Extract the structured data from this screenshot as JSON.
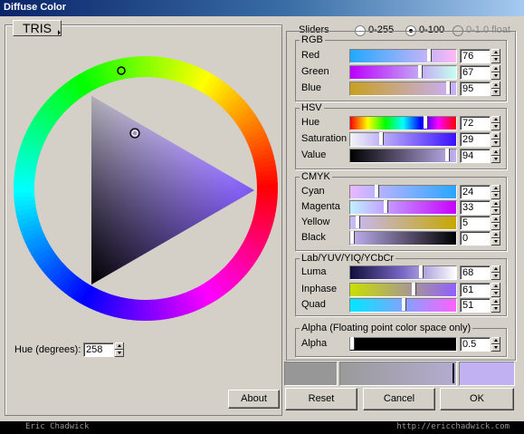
{
  "window": {
    "title": "Diffuse Color"
  },
  "left": {
    "mode_button": "TRIS",
    "hue_label": "Hue (degrees):",
    "hue_value": "258",
    "about_button": "About"
  },
  "sliders": {
    "label": "Sliders",
    "radios": [
      {
        "label": "0-255",
        "selected": false
      },
      {
        "label": "0-100",
        "selected": true
      },
      {
        "label": "0-1.0 float",
        "selected": false,
        "disabled": true
      }
    ]
  },
  "groups": {
    "rgb": {
      "title": "RGB",
      "rows": [
        {
          "label": "Red",
          "value": "76"
        },
        {
          "label": "Green",
          "value": "67"
        },
        {
          "label": "Blue",
          "value": "95"
        }
      ]
    },
    "hsv": {
      "title": "HSV",
      "rows": [
        {
          "label": "Hue",
          "value": "72"
        },
        {
          "label": "Saturation",
          "value": "29"
        },
        {
          "label": "Value",
          "value": "94"
        }
      ]
    },
    "cmyk": {
      "title": "CMYK",
      "rows": [
        {
          "label": "Cyan",
          "value": "24"
        },
        {
          "label": "Magenta",
          "value": "33"
        },
        {
          "label": "Yellow",
          "value": "5"
        },
        {
          "label": "Black",
          "value": "0"
        }
      ]
    },
    "lab": {
      "title": "Lab/YUV/YIQ/YCbCr",
      "rows": [
        {
          "label": "Luma",
          "value": "68"
        },
        {
          "label": "Inphase",
          "value": "61"
        },
        {
          "label": "Quad",
          "value": "51"
        }
      ]
    },
    "alpha": {
      "title": "Alpha (Floating point color space only)",
      "rows": [
        {
          "label": "Alpha",
          "value": "0.5"
        }
      ]
    }
  },
  "buttons": {
    "reset": "Reset",
    "cancel": "Cancel",
    "ok": "OK"
  },
  "colors": {
    "current": "#c2b1f2",
    "previous": "#979797"
  },
  "footer": {
    "left": "Eric Chadwick",
    "right": "http://ericchadwick.com"
  }
}
